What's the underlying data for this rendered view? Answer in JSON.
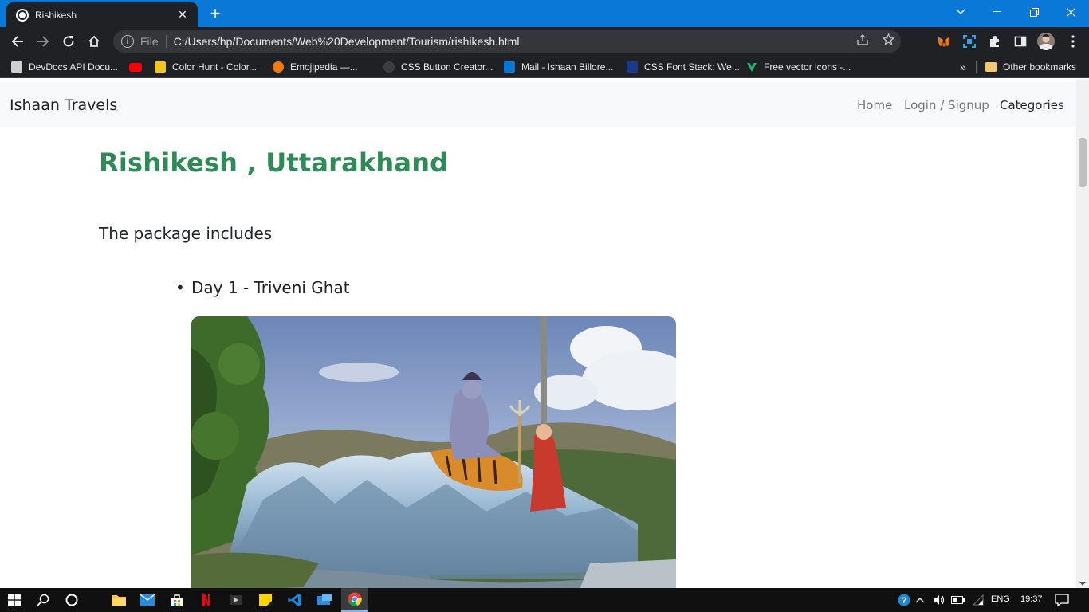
{
  "browser": {
    "tab_title": "Rishikesh",
    "tab_close": "✕",
    "new_tab": "+",
    "address_scheme": "File",
    "address_url": "C:/Users/hp/Documents/Web%20Development/Tourism/rishikesh.html"
  },
  "bookmarks": {
    "items": [
      {
        "label": "DevDocs API Docu...",
        "color": "#cfcfcf"
      },
      {
        "label": "",
        "color": "#ff0000"
      },
      {
        "label": "Color Hunt - Color...",
        "color": "#f5c518"
      },
      {
        "label": "Emojipedia —...",
        "color": "#f57c00"
      },
      {
        "label": "CSS Button Creator...",
        "color": "#3c4043"
      },
      {
        "label": "Mail - Ishaan Billore...",
        "color": "#0078d4"
      },
      {
        "label": "CSS Font Stack: We...",
        "color": "#1a3a8c"
      },
      {
        "label": "Free vector icons -...",
        "color": "#1fb471"
      }
    ],
    "overflow": "»",
    "other": "Other bookmarks"
  },
  "page": {
    "brand": "Ishaan Travels",
    "nav": {
      "home": "Home",
      "login": "Login / Signup",
      "categories": "Categories"
    },
    "heading": "Rishikesh , Uttarakhand",
    "package_text": "The package includes",
    "days": [
      {
        "bullet": "•",
        "label": "Day 1 - Triveni Ghat"
      }
    ]
  },
  "colors": {
    "heading": "#2e8b57",
    "titlebar": "#0a78d6",
    "toolbar": "#202124"
  },
  "taskbar": {
    "language": "ENG",
    "time": "19:37"
  }
}
